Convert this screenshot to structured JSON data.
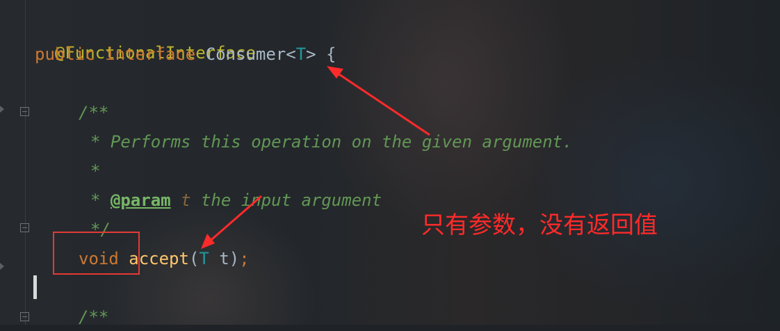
{
  "code": {
    "annotation": "@FunctionalInterface",
    "decl_public": "public",
    "decl_interface": "interface",
    "decl_name": "Consumer",
    "decl_lt": "<",
    "decl_type": "T",
    "decl_rest": "> {",
    "doc_open": "/**",
    "doc_line1": "* Performs this operation on the given argument.",
    "doc_star": "*",
    "doc_star2": "*",
    "doc_tag": "@param",
    "doc_param": "t",
    "doc_param_desc": "the input argument",
    "doc_close": "*/",
    "method_void": "void",
    "method_name": "accept",
    "method_paren_open": "(",
    "method_type": "T",
    "method_arg": "t)",
    "method_semi": ";",
    "doc_open2": "/**"
  },
  "annotation_note": "只有参数，没有返回值",
  "colors": {
    "keyword": "#cc7832",
    "annotation": "#bbb529",
    "type_param": "#20999d",
    "doc": "#629755",
    "note": "#ff2a2a"
  }
}
